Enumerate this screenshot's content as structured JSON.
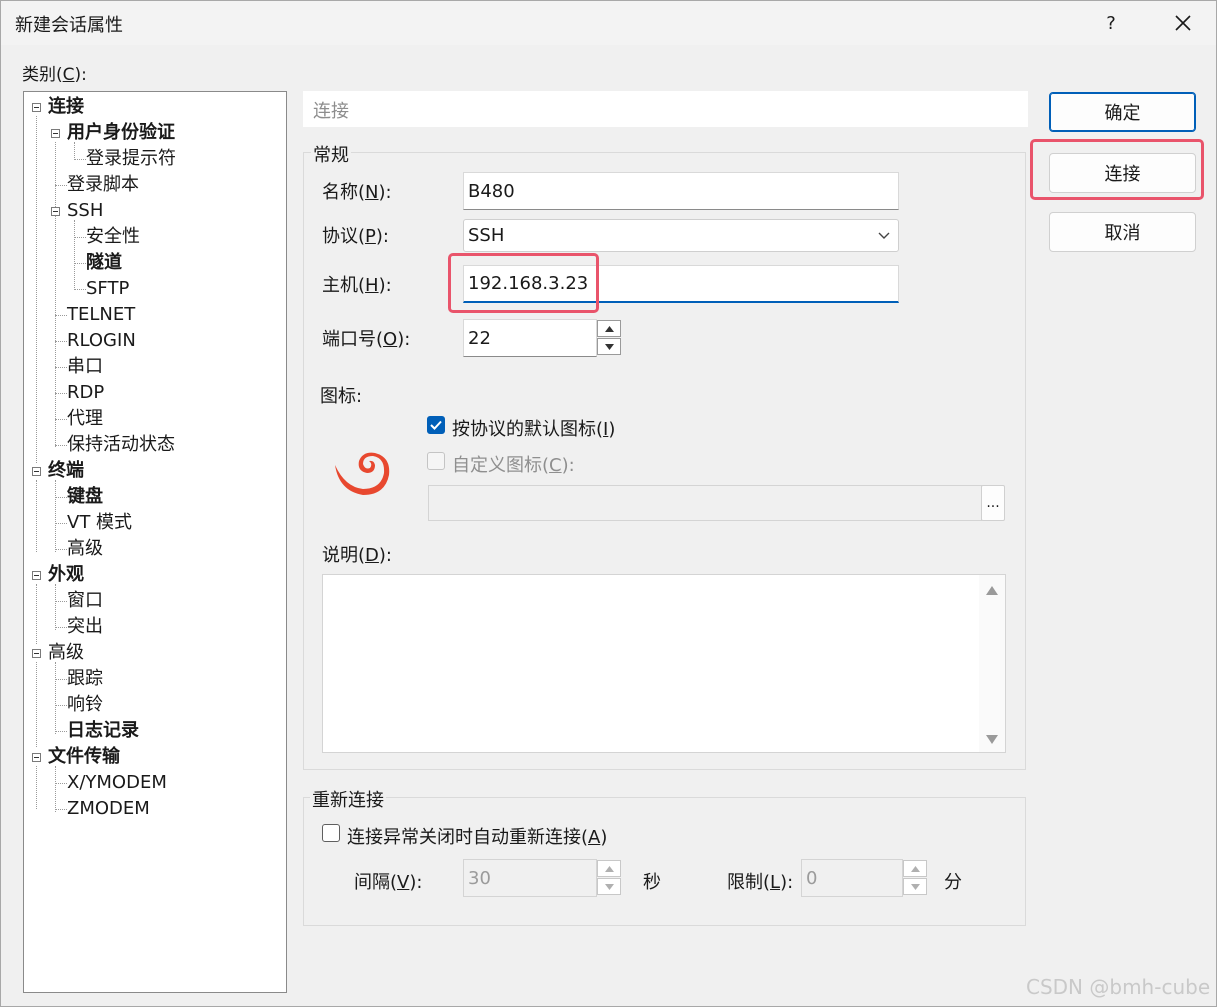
{
  "window": {
    "title": "新建会话属性",
    "help_label": "?"
  },
  "category": {
    "label_prefix": "类别(",
    "accel": "C",
    "label_suffix": "):"
  },
  "tree": {
    "items": [
      {
        "label": "连接"
      },
      {
        "label": "用户身份验证"
      },
      {
        "label": "登录提示符"
      },
      {
        "label": "登录脚本"
      },
      {
        "label": "SSH"
      },
      {
        "label": "安全性"
      },
      {
        "label": "隧道"
      },
      {
        "label": "SFTP"
      },
      {
        "label": "TELNET"
      },
      {
        "label": "RLOGIN"
      },
      {
        "label": "串口"
      },
      {
        "label": "RDP"
      },
      {
        "label": "代理"
      },
      {
        "label": "保持活动状态"
      },
      {
        "label": "终端"
      },
      {
        "label": "键盘"
      },
      {
        "label": "VT 模式"
      },
      {
        "label": "高级"
      },
      {
        "label": "外观"
      },
      {
        "label": "窗口"
      },
      {
        "label": "突出"
      },
      {
        "label": "高级"
      },
      {
        "label": "跟踪"
      },
      {
        "label": "响铃"
      },
      {
        "label": "日志记录"
      },
      {
        "label": "文件传输"
      },
      {
        "label": "X/YMODEM"
      },
      {
        "label": "ZMODEM"
      }
    ]
  },
  "panel": {
    "section_title": "连接",
    "general": {
      "group_title": "常规",
      "name_label": {
        "prefix": "名称(",
        "accel": "N",
        "suffix": "):"
      },
      "name_value": "B480",
      "protocol_label": {
        "prefix": "协议(",
        "accel": "P",
        "suffix": "):"
      },
      "protocol_value": "SSH",
      "host_label": {
        "prefix": "主机(",
        "accel": "H",
        "suffix": "):"
      },
      "host_value": "192.168.3.23",
      "port_label": {
        "prefix": "端口号(",
        "accel": "O",
        "suffix": "):"
      },
      "port_value": "22",
      "icon_label": "图标:",
      "default_icon_checkbox": {
        "prefix": "按协议的默认图标(",
        "accel": "I",
        "suffix": ")",
        "checked": true
      },
      "custom_icon_checkbox": {
        "prefix": "自定义图标(",
        "accel": "C",
        "suffix": "):",
        "checked": false
      },
      "browse_label": "...",
      "description_label": {
        "prefix": "说明(",
        "accel": "D",
        "suffix": "):"
      }
    },
    "reconnect": {
      "group_title": "重新连接",
      "auto_reconnect_checkbox": {
        "prefix": "连接异常关闭时自动重新连接(",
        "accel": "A",
        "suffix": ")",
        "checked": false
      },
      "interval_label": {
        "prefix": "间隔(",
        "accel": "V",
        "suffix": "):"
      },
      "interval_value": "30",
      "interval_unit": "秒",
      "limit_label": {
        "prefix": "限制(",
        "accel": "L",
        "suffix": "):"
      },
      "limit_value": "0",
      "limit_unit": "分"
    }
  },
  "buttons": {
    "ok": "确定",
    "connect": "连接",
    "cancel": "取消"
  },
  "watermark": "CSDN @bmh-cube",
  "colors": {
    "accent": "#005fb8",
    "highlight": "#e9546b",
    "icon": "#e8482f"
  }
}
